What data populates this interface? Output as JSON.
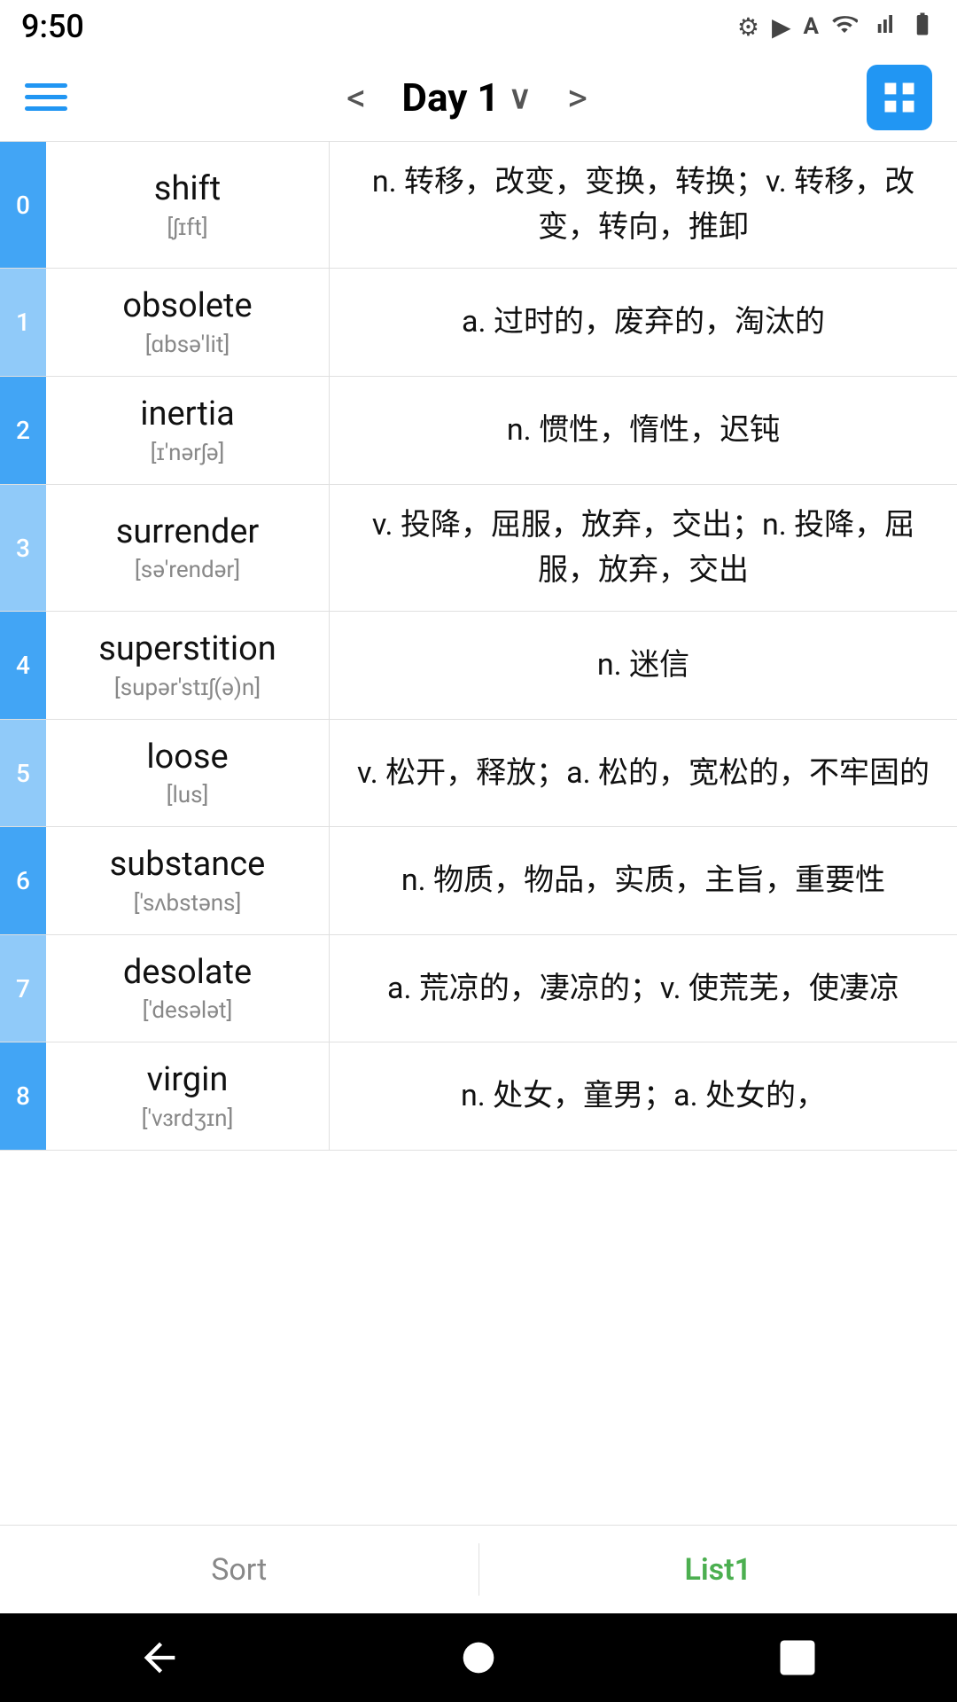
{
  "statusBar": {
    "time": "9:50",
    "icons": [
      "gear",
      "play-circle",
      "A",
      "wifi",
      "signal",
      "battery"
    ]
  },
  "toolbar": {
    "menuLabel": "Menu",
    "prevLabel": "<",
    "nextLabel": ">",
    "title": "Day 1",
    "titleDropdown": true,
    "gridLabel": "Grid View"
  },
  "words": [
    {
      "index": "0",
      "english": "shift",
      "phonetic": "[ʃɪft]",
      "definition": "n. 转移，改变，变换，转换；v. 转移，改变，转向，推卸"
    },
    {
      "index": "1",
      "english": "obsolete",
      "phonetic": "[ɑbsə'lit]",
      "definition": "a. 过时的，废弃的，淘汰的"
    },
    {
      "index": "2",
      "english": "inertia",
      "phonetic": "[ɪ'nərʃə]",
      "definition": "n. 惯性，惰性，迟钝"
    },
    {
      "index": "3",
      "english": "surrender",
      "phonetic": "[sə'rendər]",
      "definition": "v. 投降，屈服，放弃，交出；n. 投降，屈服，放弃，交出"
    },
    {
      "index": "4",
      "english": "superstition",
      "phonetic": "[supər'stɪʃ(ə)n]",
      "definition": "n. 迷信"
    },
    {
      "index": "5",
      "english": "loose",
      "phonetic": "[lus]",
      "definition": "v. 松开，释放；a. 松的，宽松的，不牢固的"
    },
    {
      "index": "6",
      "english": "substance",
      "phonetic": "['sʌbstəns]",
      "definition": "n. 物质，物品，实质，主旨，重要性"
    },
    {
      "index": "7",
      "english": "desolate",
      "phonetic": "['desələt]",
      "definition": "a. 荒凉的，凄凉的；v. 使荒芜，使凄凉"
    },
    {
      "index": "8",
      "english": "virgin",
      "phonetic": "['vɜrdʒɪn]",
      "definition": "n. 处女，童男；a. 处女的，"
    }
  ],
  "bottomTabs": [
    {
      "label": "Sort",
      "active": false
    },
    {
      "label": "List1",
      "active": true
    }
  ],
  "navBar": {
    "back": "back",
    "home": "home",
    "recents": "recents"
  }
}
